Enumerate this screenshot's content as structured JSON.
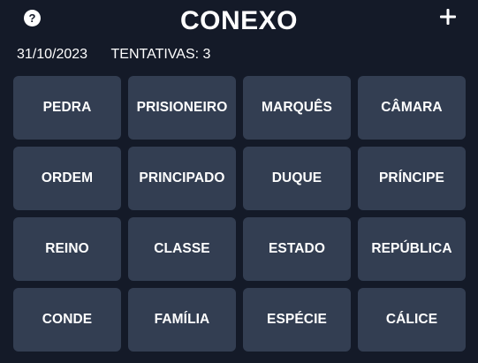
{
  "header": {
    "title": "CONEXO",
    "help_icon": "help-circle-icon",
    "help_glyph": "?",
    "new_game_icon": "plus-icon"
  },
  "info": {
    "date": "31/10/2023",
    "attempts": "TENTATIVAS: 3"
  },
  "colors": {
    "background": "#141a28",
    "tile": "#333e52",
    "text": "#ffffff"
  },
  "tiles": [
    "PEDRA",
    "PRISIONEIRO",
    "MARQUÊS",
    "CÂMARA",
    "ORDEM",
    "PRINCIPADO",
    "DUQUE",
    "PRÍNCIPE",
    "REINO",
    "CLASSE",
    "ESTADO",
    "REPÚBLICA",
    "CONDE",
    "FAMÍLIA",
    "ESPÉCIE",
    "CÁLICE"
  ]
}
